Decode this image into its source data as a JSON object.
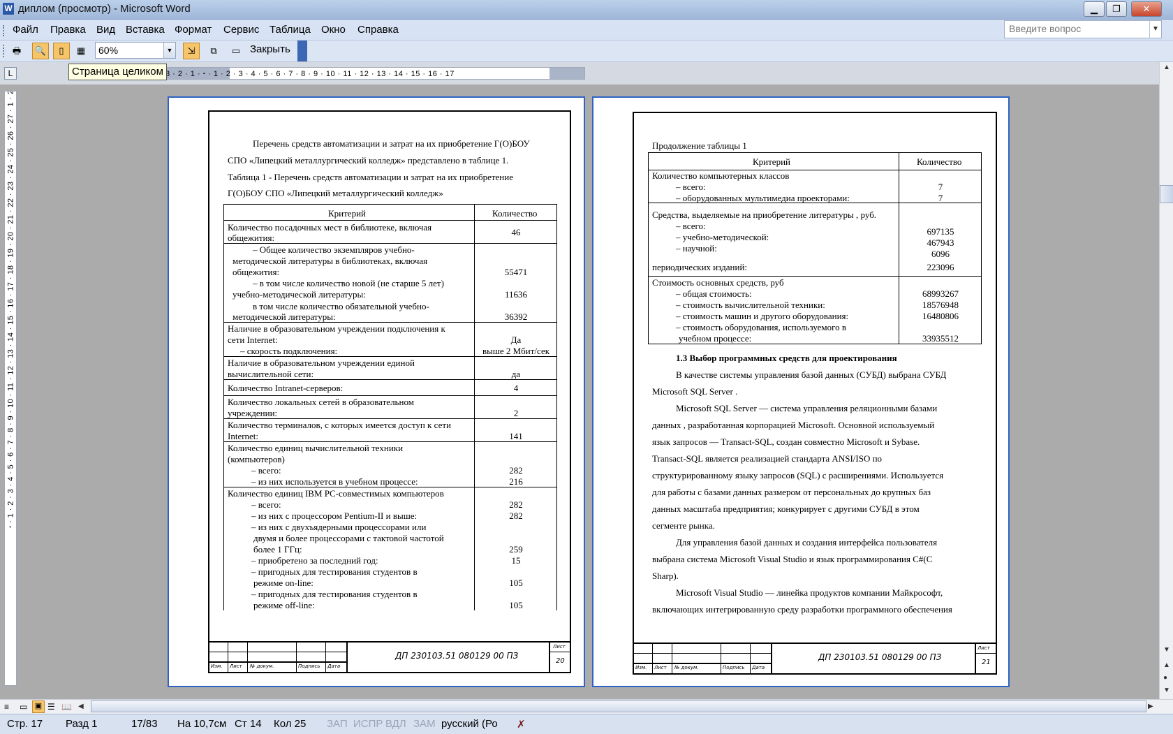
{
  "window": {
    "title": "диплом (просмотр) - Microsoft Word",
    "controls": {
      "minimize": "▁",
      "maximize": "❐",
      "close": "✕"
    }
  },
  "menu": {
    "items": [
      "Файл",
      "Правка",
      "Вид",
      "Вставка",
      "Формат",
      "Сервис",
      "Таблица",
      "Окно",
      "Справка"
    ],
    "help_placeholder": "Введите вопрос"
  },
  "toolbar": {
    "zoom": "60%",
    "close_label": "Закрыть",
    "icons": [
      "print-icon",
      "magnifier-icon",
      "one-page-icon",
      "multiple-pages-icon",
      "shrink-to-fit-icon",
      "full-screen-icon"
    ]
  },
  "tooltip": "Страница целиком",
  "ruler": {
    "horizontal": "3 · 2 · 1 · ꞏ · 1 · 2 · 3 · 4 · 5 · 6 · 7 · 8 · 9 · 10 · 11 · 12 · 13 · 14 · 15 · 16 · 17",
    "vertical": "2 · 1 · ꞏ · 1 · 2 · 3 · 4 · 5 · 6 · 7 · 8 · 9 · 10 · 11 · 12 · 13 · 14 · 15 · 16 · 17 · 18 · 19 · 20 · 21 · 22 · 23 · 24 · 25 · 26 · 27"
  },
  "status": {
    "page": "Стр. 17",
    "section": "Разд 1",
    "pages": "17/83",
    "at": "На 10,7см",
    "line": "Ст 14",
    "col": "Кол 25",
    "rec": "ЗАП",
    "trk": "ИСПР",
    "ext": "ВДЛ",
    "ovr": "ЗАМ",
    "language": "русский (Ро"
  },
  "page1": {
    "intro": [
      "Перечень средств автоматизации и затрат на их приобретение Г(О)БОУ",
      "СПО «Липецкий металлургический колледж» представлено в таблице 1."
    ],
    "caption": [
      "Таблица 1 - Перечень средств автоматизации и затрат на их приобретение",
      "Г(О)БОУ СПО «Липецкий металлургический колледж»"
    ],
    "header": {
      "criterion": "Критерий",
      "quantity": "Количество"
    },
    "left_lines": [
      "Количество посадочных мест в библиотеке, включая",
      "общежития:",
      "–    Общее количество экземпляров учебно-",
      "методической литературы в библиотеках, включая",
      "общежития:",
      "–    в том числе количество новой (не старше 5 лет)",
      "учебно-методической литературы:",
      "в том числе количество обязательной учебно-",
      "методической литературы:",
      "Наличие в образовательном учреждении подключения к",
      "сети Internet:",
      "– скорость подключения:",
      "Наличие в образовательном учреждении единой",
      "вычислительной сети:",
      "Количество Intranet-серверов:",
      "Количество локальных сетей в образовательном",
      "учреждении:",
      "Количество терминалов, с которых имеется доступ к сети",
      "Internet:",
      "Количество единиц вычислительной техники",
      "(компьютеров)",
      "–       всего:",
      "–       из них используется в учебном процессе:",
      "Количество единиц IBM PC-совместимых компьютеров",
      "–       всего:",
      "–       из них с процессором Pentium-II и выше:",
      "–       из них с двухъядерными процессорами или",
      "двумя и более процессорами с тактовой частотой",
      "более 1 ГГц:",
      "–       приобретено за последний год:",
      "–       пригодных для тестирования студентов в",
      "режиме on-line:",
      "–       пригодных для тестирования студентов в",
      "режиме off-line:"
    ],
    "values": [
      "46",
      "55471",
      "11636",
      "36392",
      "Да",
      "выше 2 Мбит/сек",
      "да",
      "4",
      "2",
      "141",
      "282",
      "216",
      "282",
      "282",
      "259",
      "15",
      "105",
      "105"
    ],
    "stamp": {
      "code": "ДП 230103.51 080129 00 ПЗ",
      "sheet_label": "Лист",
      "sheet": "20",
      "cols": [
        "Изм.",
        "Лист",
        "№ докум.",
        "Подпись",
        "Дата"
      ]
    }
  },
  "page2": {
    "continuation": "Продолжение таблицы 1",
    "header": {
      "criterion": "Критерий",
      "quantity": "Количество"
    },
    "left_lines": [
      "Количество компьютерных классов",
      "–       всего:",
      "–       оборудованных мультимедиа проекторами:",
      "Средства, выделяемые на приобретение литературы , руб.",
      "–       всего:",
      "–       учебно-методической:",
      "–       научной:",
      "периодических изданий:",
      "Стоимость основных средств, руб",
      "–       общая стоимость:",
      "–       стоимость вычислительной техники:",
      "–       стоимость машин и другого оборудования:",
      "–       стоимость оборудования, используемого в",
      "учебном процессе:"
    ],
    "values": [
      "7",
      "7",
      "697135",
      "467943",
      "6096",
      "223096",
      "68993267",
      "18576948",
      "16480806",
      "33935512"
    ],
    "heading": "1.3 Выбор программных средств для проектирования",
    "body": [
      "В качестве системы управления базой данных (СУБД) выбрана СУБД",
      "Microsoft SQL Server .",
      "Microsoft SQL Server — система управления реляционными базами",
      "данных , разработанная корпорацией Microsoft. Основной используемый",
      "язык запросов — Transact-SQL, создан совместно Microsoft и Sybase.",
      "Transact-SQL    является    реализацией    стандарта    ANSI/ISO    по",
      "структурированному языку запросов (SQL) с расширениями. Используется",
      "для работы с базами данных размером от персональных до крупных баз",
      "данных масштаба предприятия; конкурирует с другими СУБД в этом",
      "сегменте рынка.",
      "Для управления базой данных и создания интерфейса пользователя",
      "выбрана система Microsoft Visual Studio и язык программирования C#(C",
      "Sharp).",
      "Microsoft Visual Studio — линейка продуктов компании Майкрософт,",
      "включающих интегрированную среду разработки программного обеспечения"
    ],
    "stamp": {
      "code": "ДП 230103.51 080129 00 ПЗ",
      "sheet_label": "Лист",
      "sheet": "21",
      "cols": [
        "Изм.",
        "Лист",
        "№ докум.",
        "Подпись",
        "Дата"
      ]
    }
  }
}
